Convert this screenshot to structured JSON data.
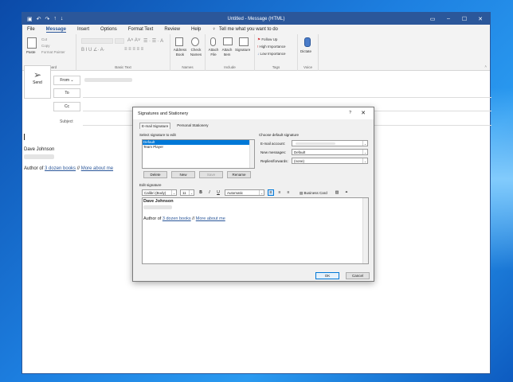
{
  "window": {
    "title": "Untitled - Message (HTML)",
    "menu": [
      "File",
      "Message",
      "Insert",
      "Options",
      "Format Text",
      "Review",
      "Help"
    ],
    "active_menu": "Message",
    "tell_me": "Tell me what you want to do"
  },
  "ribbon": {
    "clipboard": {
      "paste": "Paste",
      "cut": "Cut",
      "copy": "Copy",
      "format_painter": "Format Painter",
      "label": "Clipboard"
    },
    "basic_text": {
      "label": "Basic Text"
    },
    "names": {
      "address_book": "Address Book",
      "check_names": "Check Names",
      "label": "Names"
    },
    "include": {
      "attach_file": "Attach File",
      "attach_item": "Attach Item",
      "signature": "Signature",
      "label": "Include"
    },
    "tags": {
      "follow_up": "Follow Up",
      "high_importance": "High Importance",
      "low_importance": "Low Importance",
      "label": "Tags"
    },
    "voice": {
      "dictate": "Dictate",
      "label": "Voice"
    }
  },
  "compose": {
    "send": "Send",
    "from": "From",
    "to": "To",
    "cc": "Cc",
    "subject": "Subject",
    "sig_name": "Dave Johnson",
    "sig_line_prefix": "Author of ",
    "sig_link1": "3 dozen books",
    "sig_sep": " // ",
    "sig_link2": "More about me"
  },
  "dialog": {
    "title": "Signatures and Stationery",
    "help": "?",
    "close": "✕",
    "tabs": [
      "E-mail Signature",
      "Personal Stationery"
    ],
    "select_label": "Select signature to edit",
    "signatures": [
      "Default",
      "Team Player"
    ],
    "selected_signature": "Default",
    "buttons": {
      "delete": "Delete",
      "new": "New",
      "save": "Save",
      "rename": "Rename"
    },
    "choose_default": "Choose default signature",
    "email_account_label": "E-mail account:",
    "new_messages_label": "New messages:",
    "new_messages_value": "Default",
    "replies_label": "Replies/forwards:",
    "replies_value": "(none)",
    "edit_label": "Edit signature",
    "font_value": "Calibri (Body)",
    "size_value": "11",
    "bold": "B",
    "italic": "I",
    "underline": "U",
    "color_value": "Automatic",
    "business_card": "Business Card",
    "ok": "OK",
    "cancel": "Cancel"
  },
  "colors": {
    "outlook_blue": "#2b579a",
    "selection_blue": "#0078d7"
  }
}
